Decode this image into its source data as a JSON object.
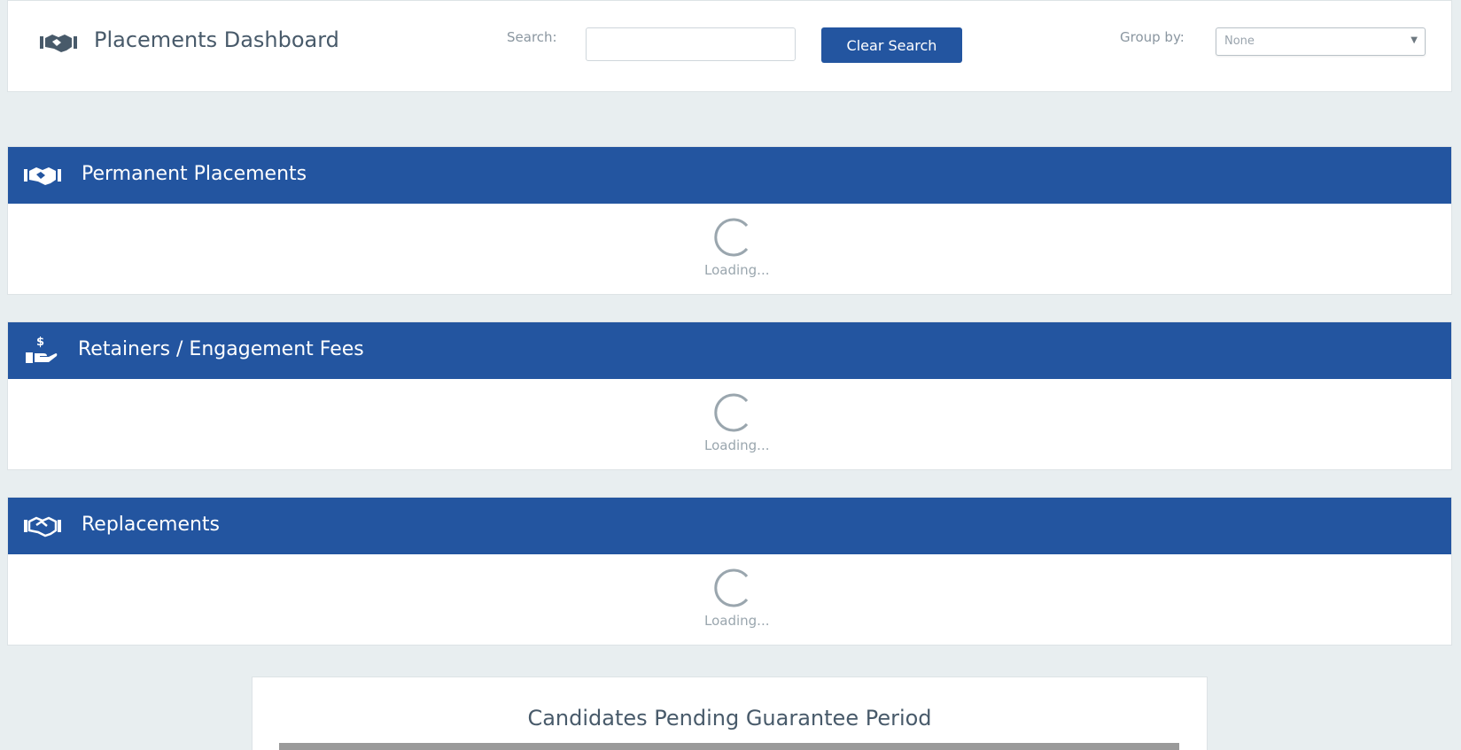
{
  "header": {
    "title": "Placements Dashboard",
    "icon": "handshake-icon",
    "search_label": "Search:",
    "search_value": "",
    "clear_search_label": "Clear Search",
    "group_by_label": "Group by:",
    "group_by_value": "None"
  },
  "sections": [
    {
      "title": "Permanent Placements",
      "icon": "handshake-icon",
      "loading_text": "Loading..."
    },
    {
      "title": "Retainers / Engagement Fees",
      "icon": "hand-holding-dollar-icon",
      "loading_text": "Loading..."
    },
    {
      "title": "Replacements",
      "icon": "handshake-outline-icon",
      "loading_text": "Loading..."
    }
  ],
  "bottom_card": {
    "title": "Candidates Pending Guarantee Period"
  },
  "colors": {
    "accent": "#2355a0",
    "background": "#e8eef0",
    "spinner": "#9aa6ae"
  }
}
